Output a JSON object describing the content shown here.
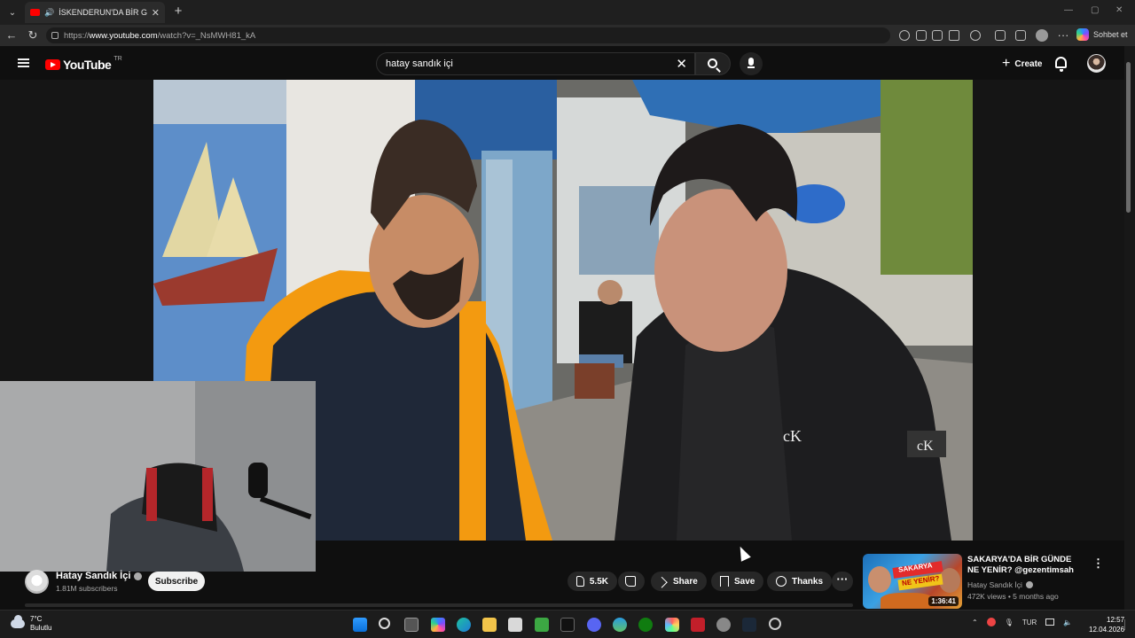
{
  "browser": {
    "tab_title": "İSKENDERUN'DA BİR GÜNDE",
    "url_prefix": "https://",
    "url_host": "www.youtube.com",
    "url_path": "/watch?v=_NsMWH81_kA",
    "copilot_label": "Sohbet et"
  },
  "youtube": {
    "logo_text": "YouTube",
    "country_code": "TR",
    "search_value": "hatay sandık içi",
    "create_label": "Create"
  },
  "video": {
    "channel_name": "Hatay Sandık İçi",
    "subscribers": "1.81M subscribers",
    "subscribe_label": "Subscribe",
    "like_count": "5.5K",
    "share_label": "Share",
    "save_label": "Save",
    "thanks_label": "Thanks",
    "more_label": "···"
  },
  "recommended": {
    "title": "SAKARYA'DA BİR GÜNDE NE YENİR? @gezentimsah",
    "channel": "Hatay Sandık İçi",
    "meta": "472K views • 5 months ago",
    "duration": "1:36:41",
    "thumb_text_1": "SAKARYA",
    "thumb_text_2": "NE YENİR?"
  },
  "taskbar": {
    "temperature": "7°C",
    "weather": "Bulutlu",
    "language": "TUR",
    "time": "12:57",
    "date": "12.04.2026"
  },
  "colors": {
    "youtube_red": "#ff0000",
    "background": "#0f0f0f",
    "pill": "#272727"
  }
}
